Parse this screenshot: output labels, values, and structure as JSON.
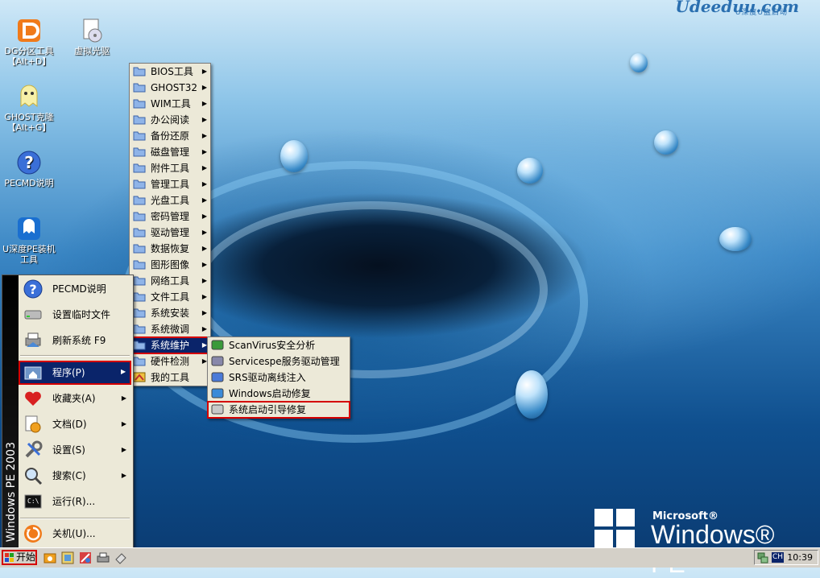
{
  "brand": {
    "top_logo": "Udeeduu",
    "top_logo_domain": ".com",
    "top_logo_sub": "U深度U盘启动",
    "winpe_company": "Microsoft®",
    "winpe_product": "Windows® PE"
  },
  "desktop_icons": [
    {
      "name": "dg-partition",
      "label": "DG分区工具【Alt+D】",
      "icon": "dg-icon"
    },
    {
      "name": "virtual-drive",
      "label": "虚拟光驱",
      "icon": "cdrom-icon"
    },
    {
      "name": "ghost",
      "label": "GHOST克隆【Alt+G】",
      "icon": "ghost-icon"
    },
    {
      "name": "pecmd-help",
      "label": "PECMD说明",
      "icon": "help-icon"
    },
    {
      "name": "udeep-install",
      "label": "U深度PE装机工具",
      "icon": "udeep-icon"
    }
  ],
  "start_menu": {
    "band_text": "Windows PE 2003",
    "items": [
      {
        "label": "PECMD说明",
        "icon": "help-icon",
        "submenu": false
      },
      {
        "label": "设置临时文件",
        "icon": "drive-icon",
        "submenu": false
      },
      {
        "label": "刷新系统 F9",
        "icon": "refresh-printer-icon",
        "submenu": false
      },
      {
        "label": "程序(P)",
        "icon": "programs-icon",
        "submenu": true,
        "selected": true
      },
      {
        "label": "收藏夹(A)",
        "icon": "heart-icon",
        "submenu": true
      },
      {
        "label": "文档(D)",
        "icon": "documents-icon",
        "submenu": true
      },
      {
        "label": "设置(S)",
        "icon": "settings-icon",
        "submenu": true
      },
      {
        "label": "搜索(C)",
        "icon": "search-icon",
        "submenu": true
      },
      {
        "label": "运行(R)...",
        "icon": "run-icon",
        "submenu": false
      },
      {
        "label": "关机(U)...",
        "icon": "shutdown-icon",
        "submenu": false
      }
    ]
  },
  "programs_menu": [
    {
      "label": "BIOS工具"
    },
    {
      "label": "GHOST32"
    },
    {
      "label": "WIM工具"
    },
    {
      "label": "办公阅读"
    },
    {
      "label": "备份还原"
    },
    {
      "label": "磁盘管理"
    },
    {
      "label": "附件工具"
    },
    {
      "label": "管理工具"
    },
    {
      "label": "光盘工具"
    },
    {
      "label": "密码管理"
    },
    {
      "label": "驱动管理"
    },
    {
      "label": "数据恢复"
    },
    {
      "label": "图形图像"
    },
    {
      "label": "网络工具"
    },
    {
      "label": "文件工具"
    },
    {
      "label": "系统安装"
    },
    {
      "label": "系统微调"
    },
    {
      "label": "系统维护",
      "selected": true
    },
    {
      "label": "硬件检测"
    },
    {
      "label": "我的工具",
      "no_arrow": true
    }
  ],
  "maintenance_menu": [
    {
      "label": "ScanVirus安全分析",
      "icon": "scanvirus-icon"
    },
    {
      "label": "Servicespe服务驱动管理",
      "icon": "services-icon"
    },
    {
      "label": "SRS驱动离线注入",
      "icon": "srs-icon"
    },
    {
      "label": "Windows启动修复",
      "icon": "windows-repair-icon"
    },
    {
      "label": "系统启动引导修复",
      "icon": "boot-repair-icon",
      "highlighted": true
    }
  ],
  "taskbar": {
    "start_label": "开始",
    "quick_launch": [
      "explorer-icon",
      "image-icon",
      "tools-icon",
      "printer-icon",
      "eraser-icon"
    ],
    "tray_lang": "CH",
    "clock": "10:39"
  },
  "colors": {
    "menu_bg": "#ece9d8",
    "selection": "#0a246a",
    "highlight_border": "#d40000"
  }
}
